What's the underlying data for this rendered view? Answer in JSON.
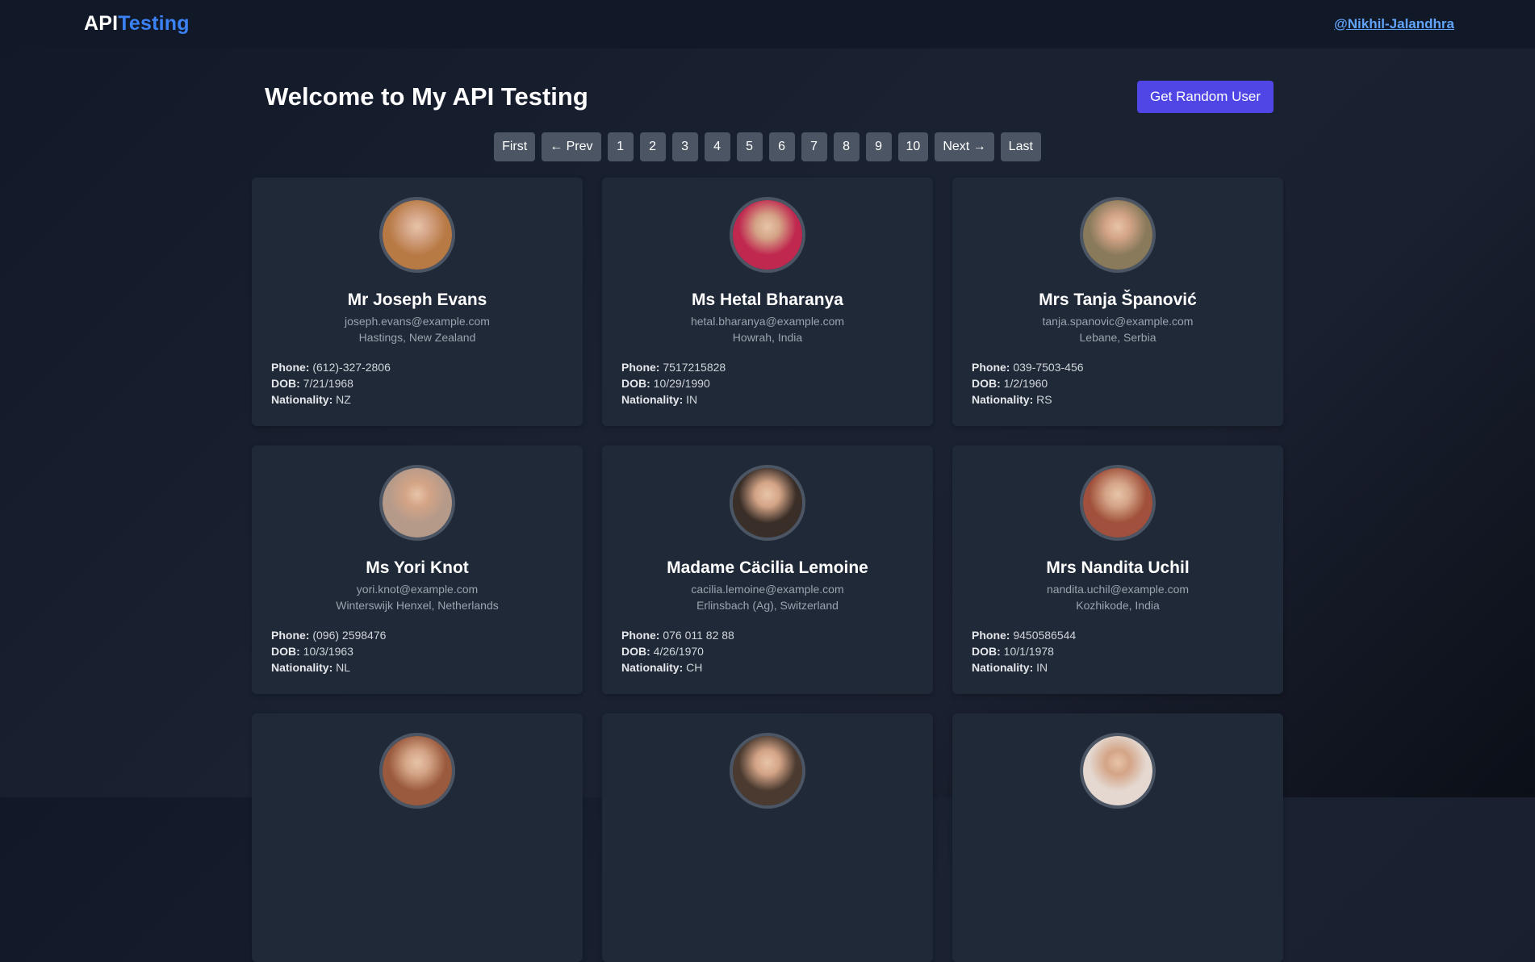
{
  "nav": {
    "brand_first": "API",
    "brand_second": "Testing",
    "user_link": "@Nikhil-Jalandhra"
  },
  "main": {
    "title": "Welcome to My API Testing",
    "random_button": "Get Random User"
  },
  "pagination": {
    "first": "First",
    "prev": "← Prev",
    "pages": [
      "1",
      "2",
      "3",
      "4",
      "5",
      "6",
      "7",
      "8",
      "9",
      "10"
    ],
    "next": "Next →",
    "last": "Last"
  },
  "labels": {
    "phone": "Phone:",
    "dob": "DOB:",
    "nationality": "Nationality:"
  },
  "users": [
    {
      "name": "Mr Joseph Evans",
      "email": "joseph.evans@example.com",
      "location": "Hastings, New Zealand",
      "phone": "(612)-327-2806",
      "dob": "7/21/1968",
      "nationality": "NZ",
      "avatar_color": "#b87a45"
    },
    {
      "name": "Ms Hetal Bharanya",
      "email": "hetal.bharanya@example.com",
      "location": "Howrah, India",
      "phone": "7517215828",
      "dob": "10/29/1990",
      "nationality": "IN",
      "avatar_color": "#c0284f"
    },
    {
      "name": "Mrs Tanja Špan​ović",
      "email": "tanja.spanovic@example.com",
      "location": "Lebane, Serbia",
      "phone": "039-7503-456",
      "dob": "1/2/1960",
      "nationality": "RS",
      "avatar_color": "#8a7a5c"
    },
    {
      "name": "Ms Yori Knot",
      "email": "yori.knot@example.com",
      "location": "Winterswijk Henxel, Netherlands",
      "phone": "(096) 2598476",
      "dob": "10/3/1963",
      "nationality": "NL",
      "avatar_color": "#b59a8a"
    },
    {
      "name": "Madame Cäcilia Lemoine",
      "email": "cacilia.lemoine@example.com",
      "location": "Erlinsbach (Ag), Switzerland",
      "phone": "076 011 82 88",
      "dob": "4/26/1970",
      "nationality": "CH",
      "avatar_color": "#3a2e28"
    },
    {
      "name": "Mrs Nandita Uchil",
      "email": "nandita.uchil@example.com",
      "location": "Kozhikode, India",
      "phone": "9450586544",
      "dob": "10/1/1978",
      "nationality": "IN",
      "avatar_color": "#a0503c"
    },
    {
      "name": "",
      "email": "",
      "location": "",
      "phone": "",
      "dob": "",
      "nationality": "",
      "avatar_color": "#9a5a3e"
    },
    {
      "name": "",
      "email": "",
      "location": "",
      "phone": "",
      "dob": "",
      "nationality": "",
      "avatar_color": "#4a3a30"
    },
    {
      "name": "",
      "email": "",
      "location": "",
      "phone": "",
      "dob": "",
      "nationality": "",
      "avatar_color": "#e4d8d0"
    }
  ]
}
